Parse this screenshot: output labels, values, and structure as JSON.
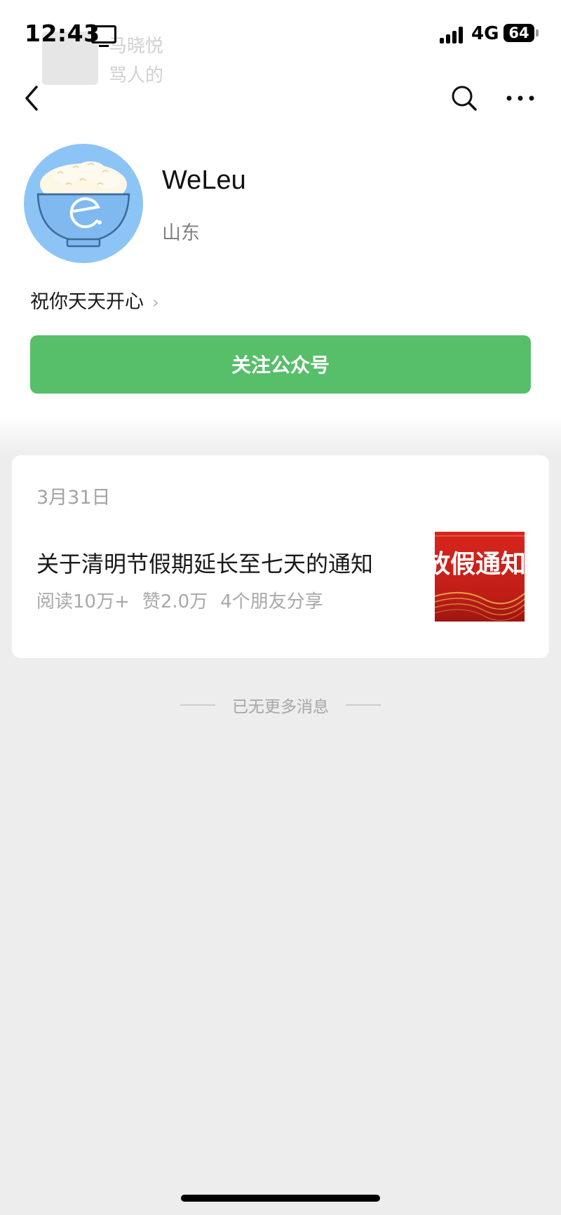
{
  "status_bar": {
    "time": "12:43",
    "network": "4G",
    "battery": "64"
  },
  "overlay_notification": {
    "line1": "马晓悦",
    "line2": "骂人的"
  },
  "nav": {
    "back_icon": "chevron-left-icon",
    "search_icon": "search-icon",
    "more_icon": "more-dots-icon"
  },
  "profile": {
    "name": "WeLeu",
    "region": "山东",
    "intro": "祝你天天开心",
    "follow_label": "关注公众号"
  },
  "article": {
    "date": "3月31日",
    "title": "关于清明节假期延长至七天的通知",
    "reads": "阅读10万+",
    "likes": "赞2.0万",
    "shares": "4个朋友分享",
    "thumb_text": "放假通知"
  },
  "footer": {
    "end_message": "已无更多消息"
  },
  "colors": {
    "accent_green": "#57be6a",
    "background": "#ededed",
    "avatar_blue": "#8cc4f6",
    "thumb_red": "#c9241e"
  }
}
